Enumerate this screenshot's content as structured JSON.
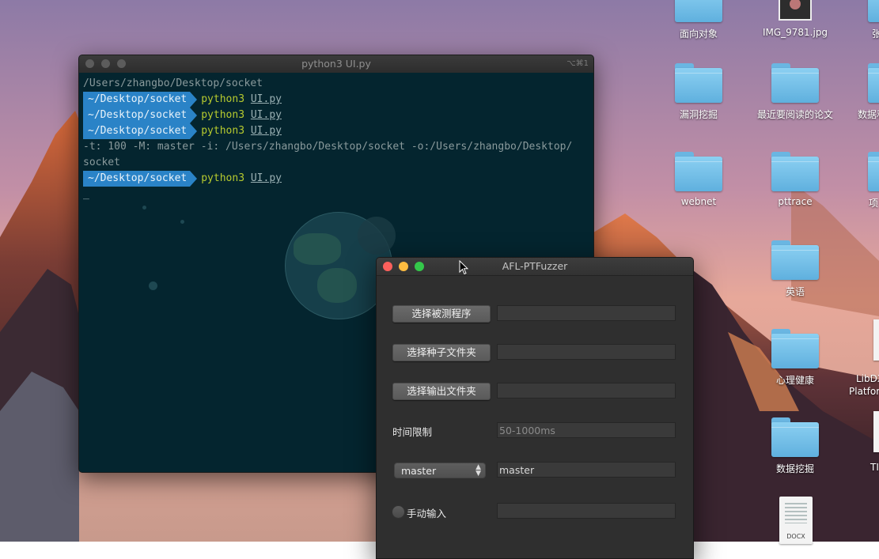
{
  "desktop": {
    "icons": [
      {
        "label": "面向对象"
      },
      {
        "label": "IMG_9781.jpg"
      },
      {
        "label": "张"
      },
      {
        "label": "漏洞挖掘"
      },
      {
        "label": "最近要阅读的论文"
      },
      {
        "label": "数据和"
      },
      {
        "label": "webnet"
      },
      {
        "label": "pttrace"
      },
      {
        "label": "项"
      },
      {
        "label": "英语"
      },
      {
        "label": "心理健康"
      },
      {
        "label": "LibDX"
      },
      {
        "label": "Platfor"
      },
      {
        "label": "数据挖掘"
      },
      {
        "label": "TI"
      },
      {
        "label": "DOCX"
      }
    ]
  },
  "terminal": {
    "title": "python3 UI.py",
    "shortcut": "⌥⌘1",
    "lines": {
      "path": "/Users/zhangbo/Desktop/socket",
      "prompt_dir": "~/Desktop/socket",
      "cmd": "python3",
      "arg": "UI.py",
      "output1": "-t: 100 -M: master  -i: /Users/zhangbo/Desktop/socket -o:/Users/zhangbo/Desktop/",
      "output2": "socket",
      "cursor": "_"
    }
  },
  "afl": {
    "title": "AFL-PTFuzzer",
    "btn_program": "选择被测程序",
    "btn_seed": "选择种子文件夹",
    "btn_output": "选择输出文件夹",
    "time_label": "时间限制",
    "time_placeholder": "50-1000ms",
    "mode_select": "master",
    "mode_value": "master",
    "manual_label": "手动输入"
  },
  "colors": {
    "close": "#fc605c",
    "minimize": "#fdbc40",
    "maximize": "#34c84a",
    "prompt_bg": "#2a83c7",
    "cmd": "#b6ca2f"
  }
}
